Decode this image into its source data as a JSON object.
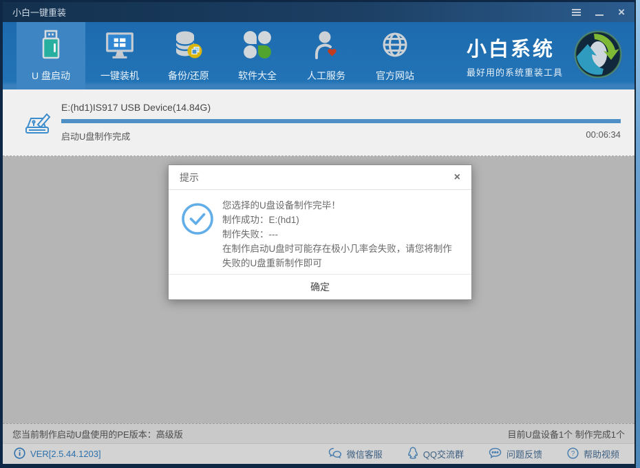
{
  "window": {
    "title": "小白一键重装"
  },
  "titlebar": {
    "icons": [
      "menu-icon",
      "minimize-icon",
      "close-icon"
    ]
  },
  "nav": {
    "tabs": [
      {
        "label": "U 盘启动",
        "icon": "usb-drive-icon",
        "active": true
      },
      {
        "label": "一键装机",
        "icon": "monitor-windows-icon",
        "active": false
      },
      {
        "label": "备份/还原",
        "icon": "database-backup-icon",
        "active": false
      },
      {
        "label": "软件大全",
        "icon": "clover-apps-icon",
        "active": false
      },
      {
        "label": "人工服务",
        "icon": "person-heart-icon",
        "active": false
      },
      {
        "label": "官方网站",
        "icon": "globe-icon",
        "active": false
      }
    ],
    "brand": {
      "title": "小白系统",
      "subtitle": "最好用的系统重装工具",
      "logo_icon": "refresh-arrows-logo"
    }
  },
  "progress": {
    "device": "E:(hd1)IS917 USB Device(14.84G)",
    "status": "启动U盘制作完成",
    "elapsed": "00:06:34",
    "percent": 100
  },
  "dialog": {
    "title": "提示",
    "close_icon": "close-icon",
    "result_icon": "check-circle-icon",
    "lines": [
      "您选择的U盘设备制作完毕！",
      "制作成功：E:(hd1)",
      "制作失败：---",
      "在制作启动U盘时可能存在极小几率会失败，请您将制作失败的U盘重新制作即可"
    ],
    "ok_label": "确定"
  },
  "status_bar": {
    "left": "您当前制作启动U盘使用的PE版本：高级版",
    "right": "目前U盘设备1个 制作完成1个"
  },
  "footer": {
    "version": "VER[2.5.44.1203]",
    "version_icon": "info-icon",
    "links": [
      {
        "label": "微信客服",
        "icon": "wechat-icon"
      },
      {
        "label": "QQ交流群",
        "icon": "qq-icon"
      },
      {
        "label": "问题反馈",
        "icon": "feedback-bubble-icon"
      },
      {
        "label": "帮助视频",
        "icon": "help-circle-icon"
      }
    ]
  },
  "colors": {
    "nav_blue": "#2273b6",
    "active_tab_blue": "#3d85c3",
    "titlebar_navy": "#13304e",
    "progress_fill": "#4e8fc6",
    "dim_overlay_gray": "#b5b5b5",
    "accent_check_blue": "#62aee8",
    "link_blue": "#2c70ad",
    "usb_teal": "#27b0a0",
    "clover_green": "#51a52f",
    "heart_red": "#c43c1e",
    "coin_yellow": "#d8b60e"
  }
}
